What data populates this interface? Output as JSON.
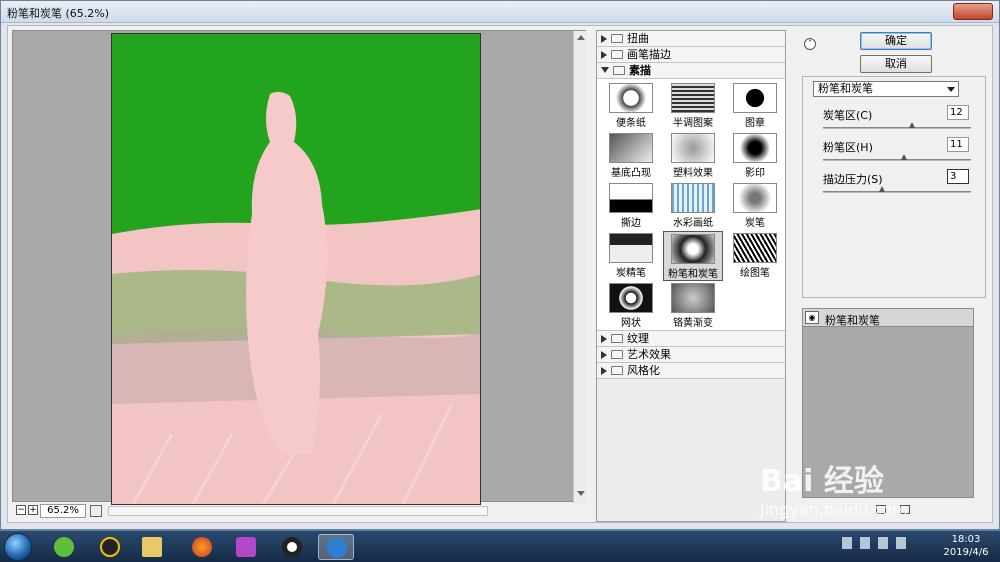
{
  "window": {
    "title": "粉笔和炭笔 (65.2%)"
  },
  "preview": {
    "zoom_minus": "−",
    "zoom_plus": "+",
    "zoom_value": "65.2%"
  },
  "gallery": {
    "categories_top": [
      {
        "label": "扭曲",
        "open": false
      },
      {
        "label": "画笔描边",
        "open": false
      },
      {
        "label": "素描",
        "open": true
      }
    ],
    "thumbs": [
      "便条纸",
      "半调图案",
      "图章",
      "基底凸现",
      "塑料效果",
      "影印",
      "撕边",
      "水彩画纸",
      "炭笔",
      "炭精笔",
      "粉笔和炭笔",
      "绘图笔",
      "网状",
      "铬黄渐变"
    ],
    "selected_thumb": "粉笔和炭笔",
    "categories_bottom": [
      {
        "label": "纹理",
        "open": false
      },
      {
        "label": "艺术效果",
        "open": false
      },
      {
        "label": "风格化",
        "open": false
      }
    ]
  },
  "panel": {
    "collapse_glyph": "˄",
    "ok_label": "确定",
    "cancel_label": "取消",
    "filter_select": "粉笔和炭笔",
    "params": [
      {
        "label": "炭笔区(C)",
        "value": "12",
        "slider": 0.6
      },
      {
        "label": "粉笔区(H)",
        "value": "11",
        "slider": 0.55
      },
      {
        "label": "描边压力(S)",
        "value": "3",
        "slider": 0.4
      }
    ]
  },
  "layers": {
    "name": "粉笔和炭笔",
    "eye_glyph": "◉"
  },
  "taskbar": {
    "time": "18:03",
    "date": "2019/4/6"
  },
  "watermark": {
    "brand": "Bai 经验",
    "url": "jingyan.baidu.com"
  }
}
